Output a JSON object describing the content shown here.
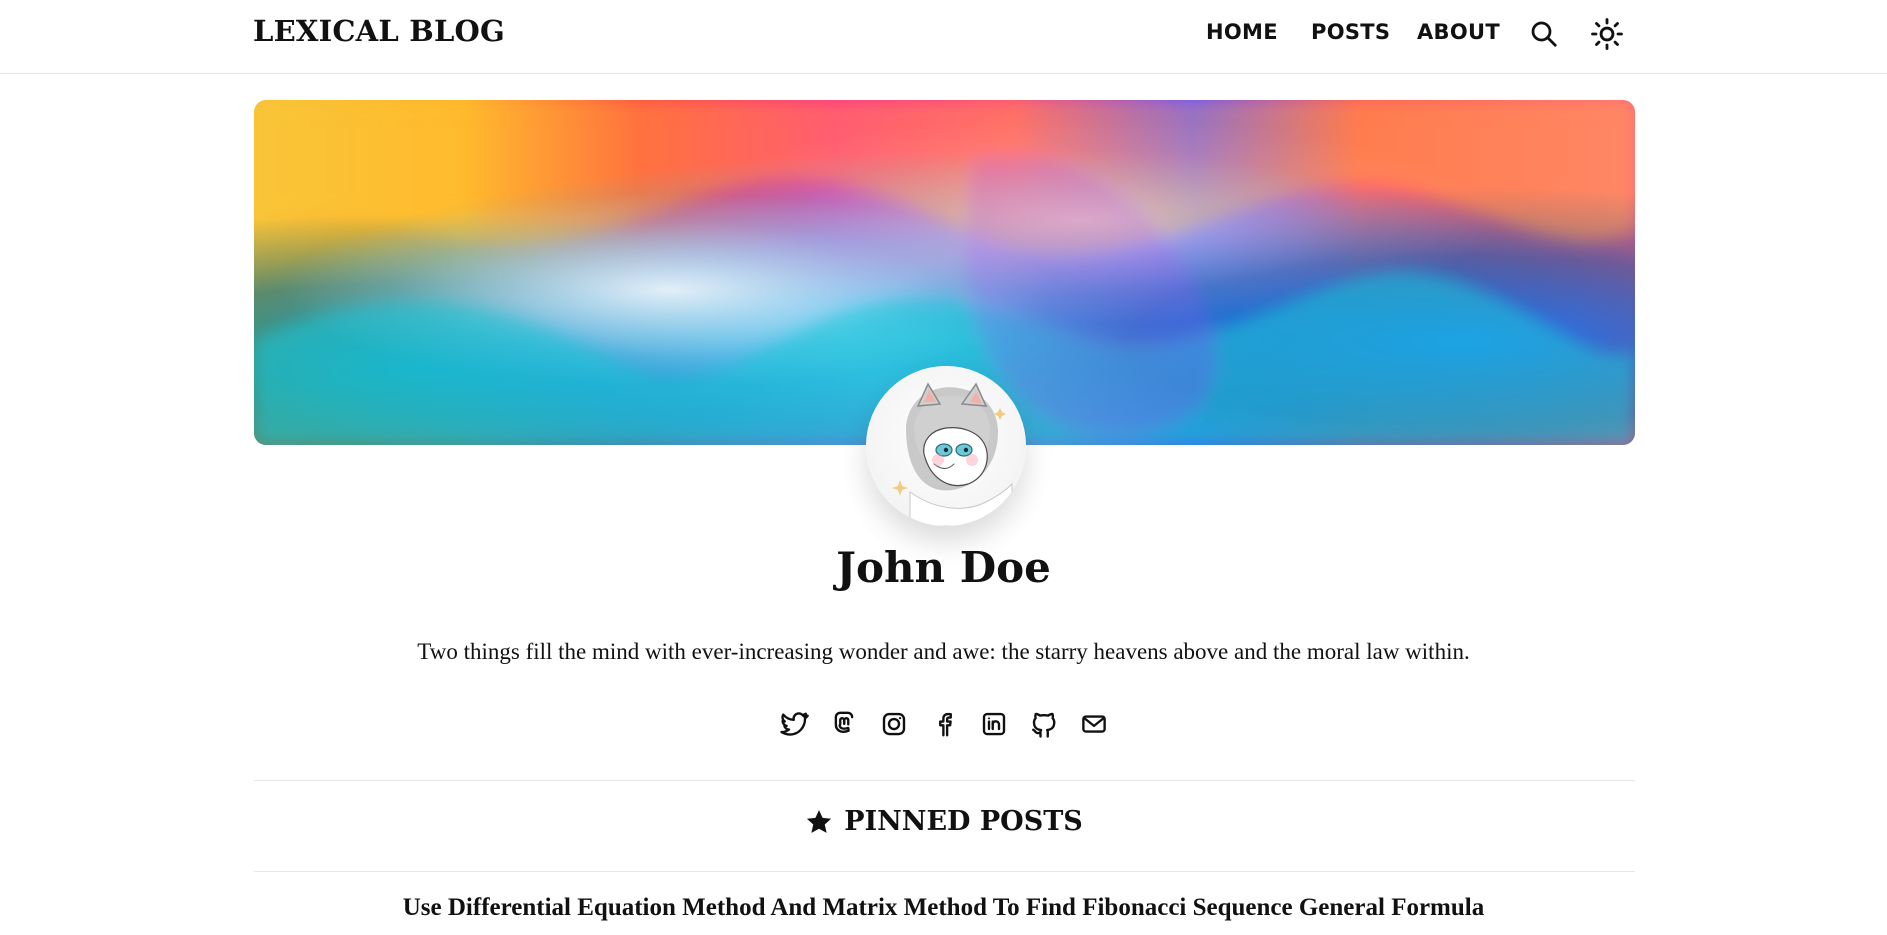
{
  "header": {
    "brand": "LEXICAL BLOG",
    "nav": [
      {
        "label": "HOME"
      },
      {
        "label": "POSTS"
      },
      {
        "label": "ABOUT"
      }
    ],
    "icons": [
      "search-icon",
      "sun-icon"
    ]
  },
  "profile": {
    "name": "John Doe",
    "bio": "Two things fill the mind with ever-increasing wonder and awe: the starry heavens above and the moral law within.",
    "socials": [
      "twitter-icon",
      "mastodon-icon",
      "instagram-icon",
      "facebook-icon",
      "linkedin-icon",
      "github-icon",
      "mail-icon"
    ]
  },
  "pinned": {
    "title": "PINNED POSTS",
    "posts": [
      {
        "title": "Use Differential Equation Method And Matrix Method To Find Fibonacci Sequence General Formula"
      }
    ]
  },
  "colors": {
    "text": "#111111",
    "divider": "#e6e6e6",
    "background": "#ffffff"
  }
}
